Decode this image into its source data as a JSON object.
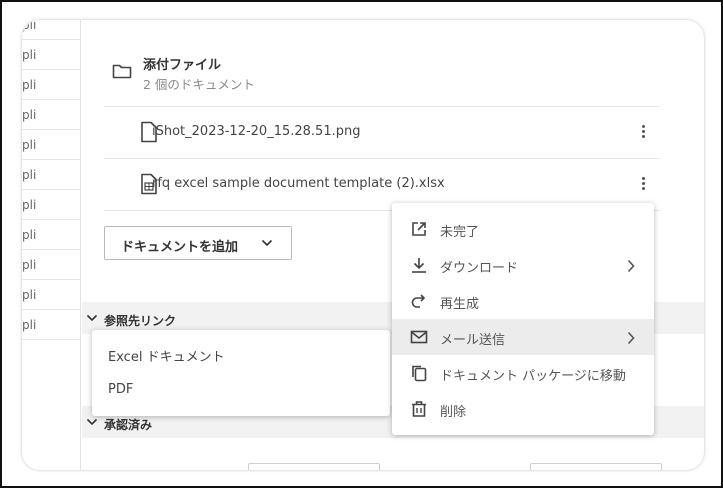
{
  "left_column": {
    "rows": [
      "pli",
      "pli",
      "pli",
      "pli",
      "pli",
      "pli",
      "pli",
      "pli",
      "pli",
      "pli",
      "pli"
    ]
  },
  "attachments": {
    "title": "添付ファイル",
    "subtitle": "2 個のドキュメント",
    "files": [
      {
        "name": "iShot_2023-12-20_15.28.51.png",
        "icon": "file-icon"
      },
      {
        "name": "rfq excel sample document template (2).xlsx",
        "icon": "spreadsheet-file-icon"
      }
    ],
    "add_button_label": "ドキュメントを追加"
  },
  "sections": {
    "references_label": "参照先リンク",
    "approved_label": "承認済み"
  },
  "context_menu": {
    "items": [
      {
        "label": "未完了",
        "icon": "open-external-icon",
        "has_submenu": false
      },
      {
        "label": "ダウンロード",
        "icon": "download-icon",
        "has_submenu": true
      },
      {
        "label": "再生成",
        "icon": "redo-icon",
        "has_submenu": false
      },
      {
        "label": "メール送信",
        "icon": "mail-icon",
        "has_submenu": true
      },
      {
        "label": "ドキュメント パッケージに移動",
        "icon": "copy-icon",
        "has_submenu": false
      },
      {
        "label": "削除",
        "icon": "trash-icon",
        "has_submenu": false
      }
    ]
  },
  "submenu": {
    "items": [
      "Excel ドキュメント",
      "PDF"
    ]
  }
}
